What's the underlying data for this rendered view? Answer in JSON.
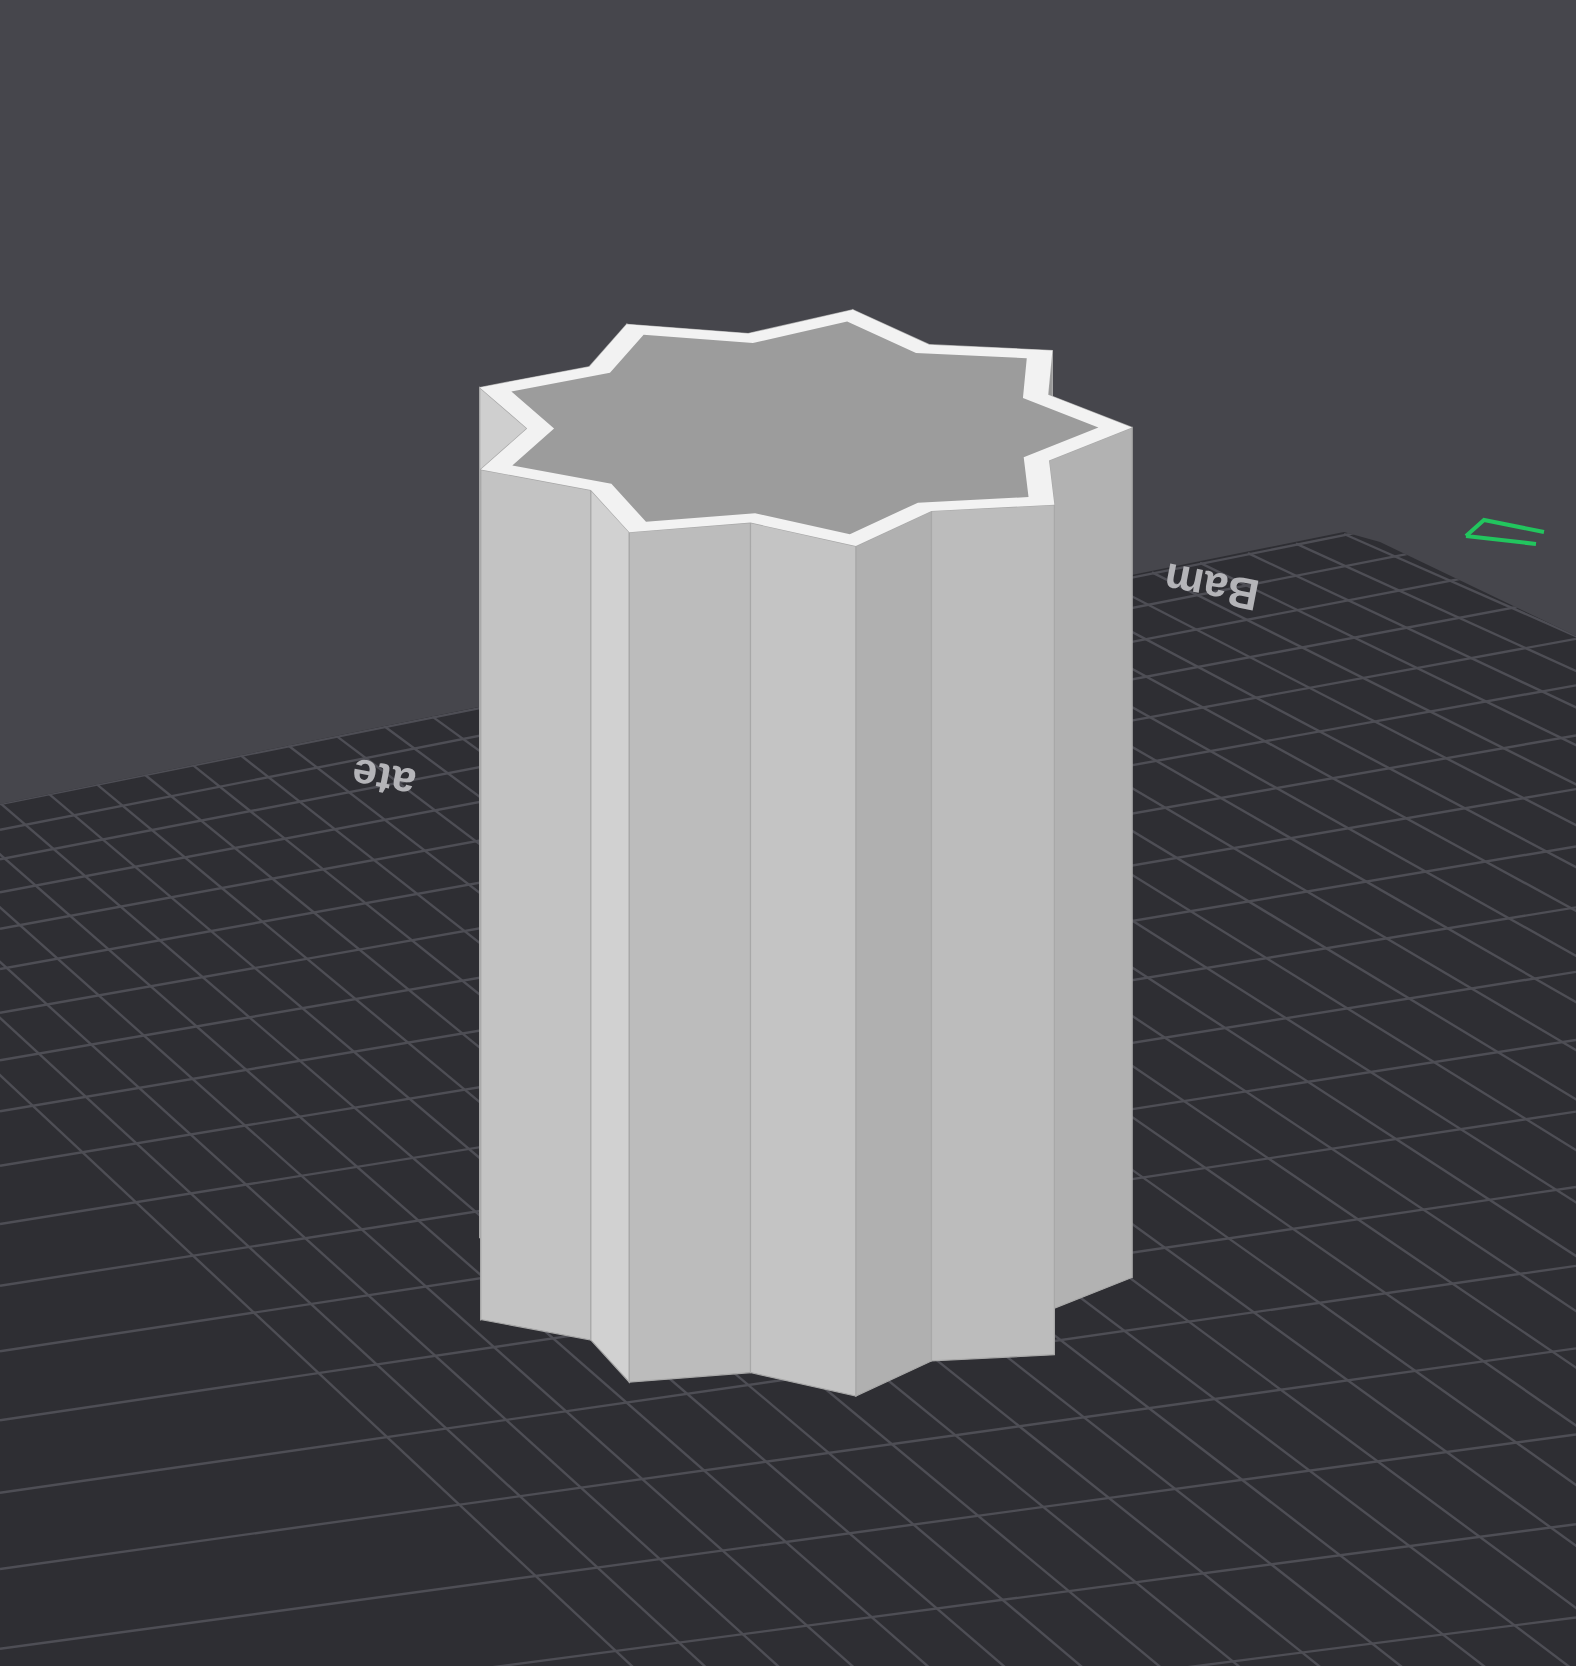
{
  "plate_labels": [
    {
      "text": "Bam"
    },
    {
      "text": "ate"
    }
  ]
}
